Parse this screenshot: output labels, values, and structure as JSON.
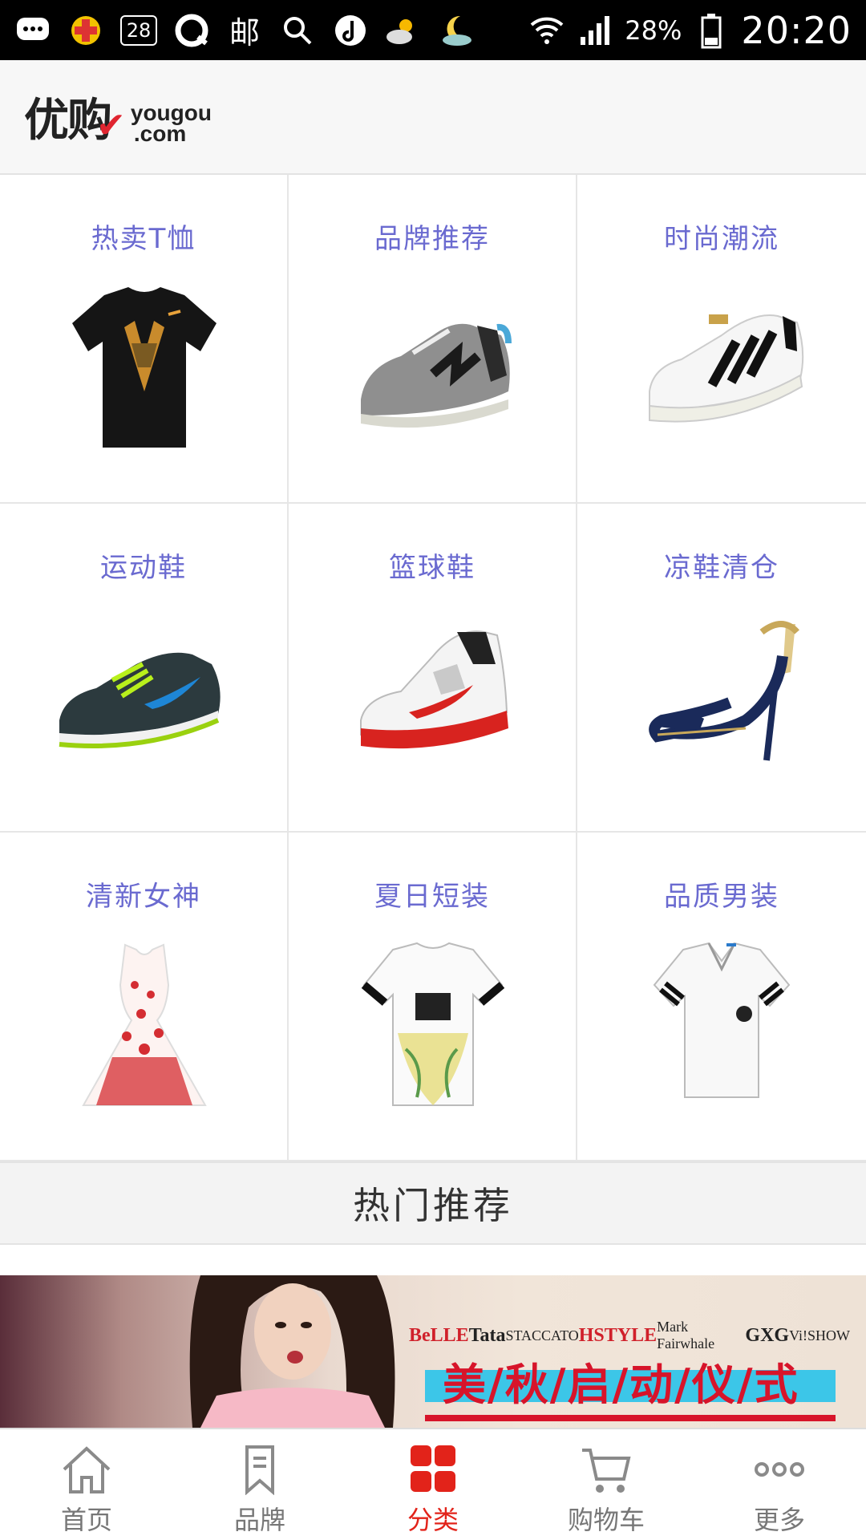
{
  "status_bar": {
    "icons": [
      "chat-icon",
      "game-icon",
      "calendar-icon",
      "browser-icon",
      "mail-icon",
      "search-icon",
      "music-icon",
      "weather-icon",
      "moon-icon",
      "wifi-icon",
      "signal-icon",
      "battery-icon"
    ],
    "calendar_day": "28",
    "mail_glyph": "邮",
    "battery_percent": "28%",
    "time": "20:20"
  },
  "header": {
    "logo_cn": "优购",
    "logo_en_top": "yougou",
    "logo_en_bottom": ".com",
    "accent_color": "#e02530"
  },
  "categories": [
    {
      "label": "热卖T恤",
      "image": "black-tshirt"
    },
    {
      "label": "品牌推荐",
      "image": "grey-sneaker"
    },
    {
      "label": "时尚潮流",
      "image": "white-striped-sneaker"
    },
    {
      "label": "运动鞋",
      "image": "running-shoe"
    },
    {
      "label": "篮球鞋",
      "image": "basketball-shoe"
    },
    {
      "label": "凉鞋清仓",
      "image": "heel-sandal"
    },
    {
      "label": "清新女神",
      "image": "floral-dress"
    },
    {
      "label": "夏日短装",
      "image": "printed-tshirt"
    },
    {
      "label": "品质男装",
      "image": "polo-shirt"
    }
  ],
  "hot_section": {
    "title": "热门推荐"
  },
  "banner": {
    "brands": [
      "BeLLE",
      "Tata",
      "STACCATO",
      "HSTYLE",
      "Mark Fairwhale",
      "GXG",
      "Vi!SHOW"
    ],
    "slogan": "美/秋/启/动/仪/式"
  },
  "tabbar": {
    "active_color": "#e2231a",
    "items": [
      {
        "label": "首页",
        "icon": "home-icon"
      },
      {
        "label": "品牌",
        "icon": "bookmark-icon"
      },
      {
        "label": "分类",
        "icon": "grid-icon",
        "active": true
      },
      {
        "label": "购物车",
        "icon": "cart-icon"
      },
      {
        "label": "更多",
        "icon": "more-icon"
      }
    ]
  }
}
